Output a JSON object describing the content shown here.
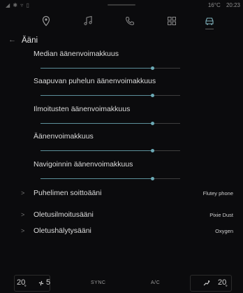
{
  "status": {
    "left_icons": "◢ ✱ ▿ ▯",
    "temperature": "16°C",
    "time": "20:23"
  },
  "tabs": [
    {
      "name": "navigation",
      "icon": "location-pin-icon"
    },
    {
      "name": "music",
      "icon": "music-note-icon"
    },
    {
      "name": "phone",
      "icon": "phone-icon"
    },
    {
      "name": "apps",
      "icon": "apps-grid-icon"
    },
    {
      "name": "vehicle",
      "icon": "car-icon",
      "active": true
    }
  ],
  "header": {
    "back_icon": "←",
    "title": "Ääni"
  },
  "volume_items": [
    {
      "label": "Median äänenvoimakkuus",
      "level": 0.8
    },
    {
      "label": "Saapuvan puhelun äänenvoimakkuus",
      "level": 0.8
    },
    {
      "label": "Ilmoitusten äänenvoimakkuus",
      "level": 0.8
    },
    {
      "label": "Äänenvoimakkuus",
      "level": 0.8
    },
    {
      "label": "Navigoinnin äänenvoimakkuus",
      "level": 0.8
    }
  ],
  "sound_rows": [
    {
      "label": "Puhelimen soittoääni",
      "value": "Flutey phone"
    },
    {
      "label": "Oletusilmoitusääni",
      "value": "Pixie Dust"
    },
    {
      "label": "Oletushälytysääni",
      "value": "Oxygen"
    }
  ],
  "bottom": {
    "left_temp": "20̥",
    "fan_level": "5",
    "sync_label": "SYNC",
    "ac_label": "A/C",
    "right_temp": "20̥"
  },
  "colors": {
    "accent": "#6ba9b5",
    "background": "#0b0b0d",
    "text": "#dcdcdc"
  }
}
